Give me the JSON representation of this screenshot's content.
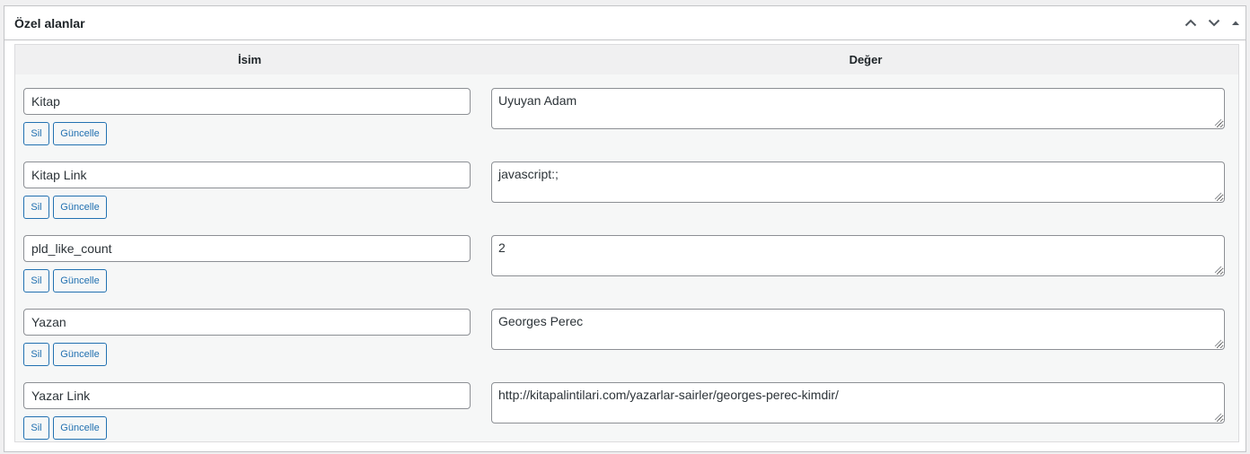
{
  "box": {
    "title": "Özel alanlar",
    "icons": [
      "chevron-up-icon",
      "chevron-down-icon",
      "triangle-up-icon"
    ]
  },
  "table": {
    "headers": {
      "name": "İsim",
      "value": "Değer"
    },
    "rows": [
      {
        "name": "Kitap",
        "value": "Uyuyan Adam",
        "delete_label": "Sil",
        "update_label": "Güncelle"
      },
      {
        "name": "Kitap Link",
        "value": "javascript:;",
        "delete_label": "Sil",
        "update_label": "Güncelle"
      },
      {
        "name": "pld_like_count",
        "value": "2",
        "delete_label": "Sil",
        "update_label": "Güncelle"
      },
      {
        "name": "Yazan",
        "value": "Georges Perec",
        "delete_label": "Sil",
        "update_label": "Güncelle"
      },
      {
        "name": "Yazar Link",
        "value": "http://kitapalintilari.com/yazarlar-sairler/georges-perec-kimdir/",
        "delete_label": "Sil",
        "update_label": "Güncelle"
      }
    ]
  },
  "colors": {
    "accent": "#2271b1",
    "border": "#8c8f94",
    "panel": "#f6f7f7"
  }
}
